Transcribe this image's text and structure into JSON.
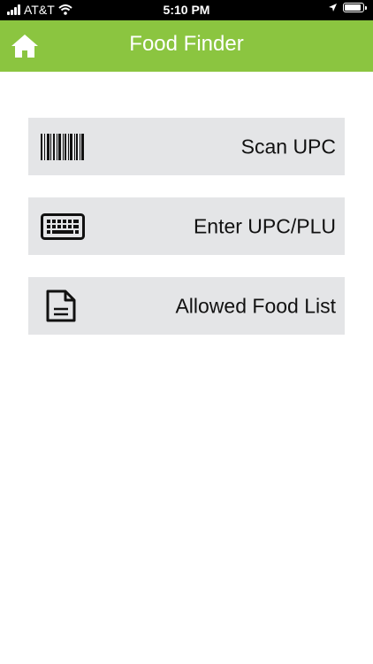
{
  "status_bar": {
    "carrier": "AT&T",
    "time": "5:10 PM"
  },
  "header": {
    "title": "Food Finder",
    "color": "#8bc540"
  },
  "menu": {
    "items": [
      {
        "label": "Scan UPC",
        "icon": "barcode-icon"
      },
      {
        "label": "Enter UPC/PLU",
        "icon": "keyboard-icon"
      },
      {
        "label": "Allowed Food List",
        "icon": "document-icon"
      }
    ]
  }
}
